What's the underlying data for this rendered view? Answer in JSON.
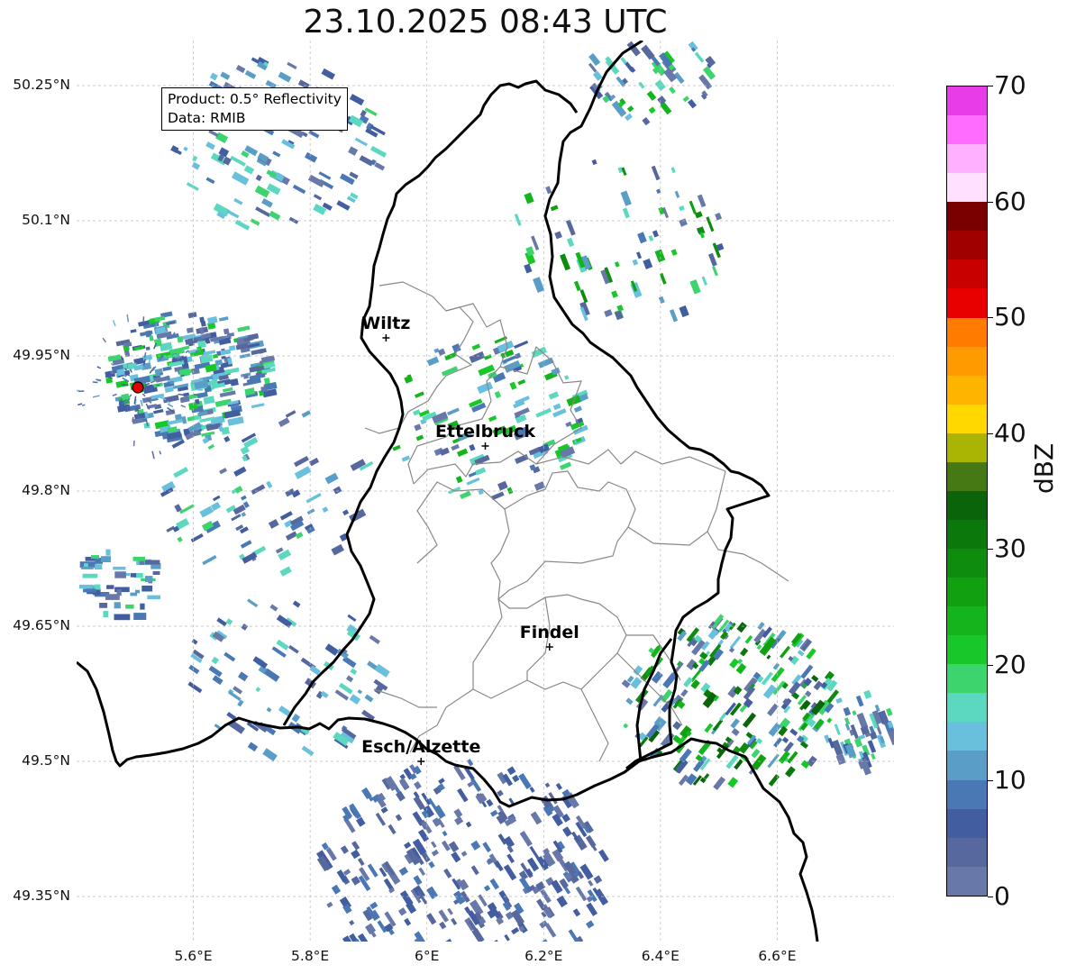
{
  "title": "23.10.2025 08:43 UTC",
  "info": {
    "product": "Product: 0.5° Reflectivity",
    "data": "Data: RMIB"
  },
  "axes": {
    "lat_labels": [
      "50.25°N",
      "50.1°N",
      "49.95°N",
      "49.8°N",
      "49.65°N",
      "49.5°N",
      "49.35°N"
    ],
    "lon_labels": [
      "5.6°E",
      "5.8°E",
      "6°E",
      "6.2°E",
      "6.4°E",
      "6.6°E"
    ],
    "lat_range": [
      49.3,
      50.3
    ],
    "lon_range": [
      5.4,
      6.8
    ]
  },
  "cities": [
    {
      "name": "Wiltz",
      "lon": 5.93,
      "lat": 49.97
    },
    {
      "name": "Ettelbruck",
      "lon": 6.1,
      "lat": 49.85
    },
    {
      "name": "Findel",
      "lon": 6.21,
      "lat": 49.627
    },
    {
      "name": "Esch/Alzette",
      "lon": 5.99,
      "lat": 49.5
    }
  ],
  "radar_site": {
    "lon": 5.505,
    "lat": 49.915
  },
  "colorbar": {
    "label": "dBZ",
    "ticks": [
      "0",
      "10",
      "20",
      "30",
      "40",
      "50",
      "60",
      "70"
    ],
    "range": [
      0,
      70
    ],
    "colors": [
      "#6878a8",
      "#56689e",
      "#425da0",
      "#4a78b4",
      "#5a9ec8",
      "#68c0dc",
      "#5cd8c0",
      "#3cd46c",
      "#18c828",
      "#14b41c",
      "#10a010",
      "#0e8c0e",
      "#0a780a",
      "#0a640a",
      "#467814",
      "#aab402",
      "#ffd800",
      "#ffb400",
      "#ff9a00",
      "#ff7c00",
      "#e80000",
      "#c80000",
      "#a00000",
      "#7a0000",
      "#ffe0ff",
      "#ffb0ff",
      "#ff6cff",
      "#e83ce8"
    ]
  },
  "colors": {
    "border": "#000000",
    "commune": "#888888",
    "grid": "#bbbbbb",
    "radar_marker": "#e00000"
  }
}
